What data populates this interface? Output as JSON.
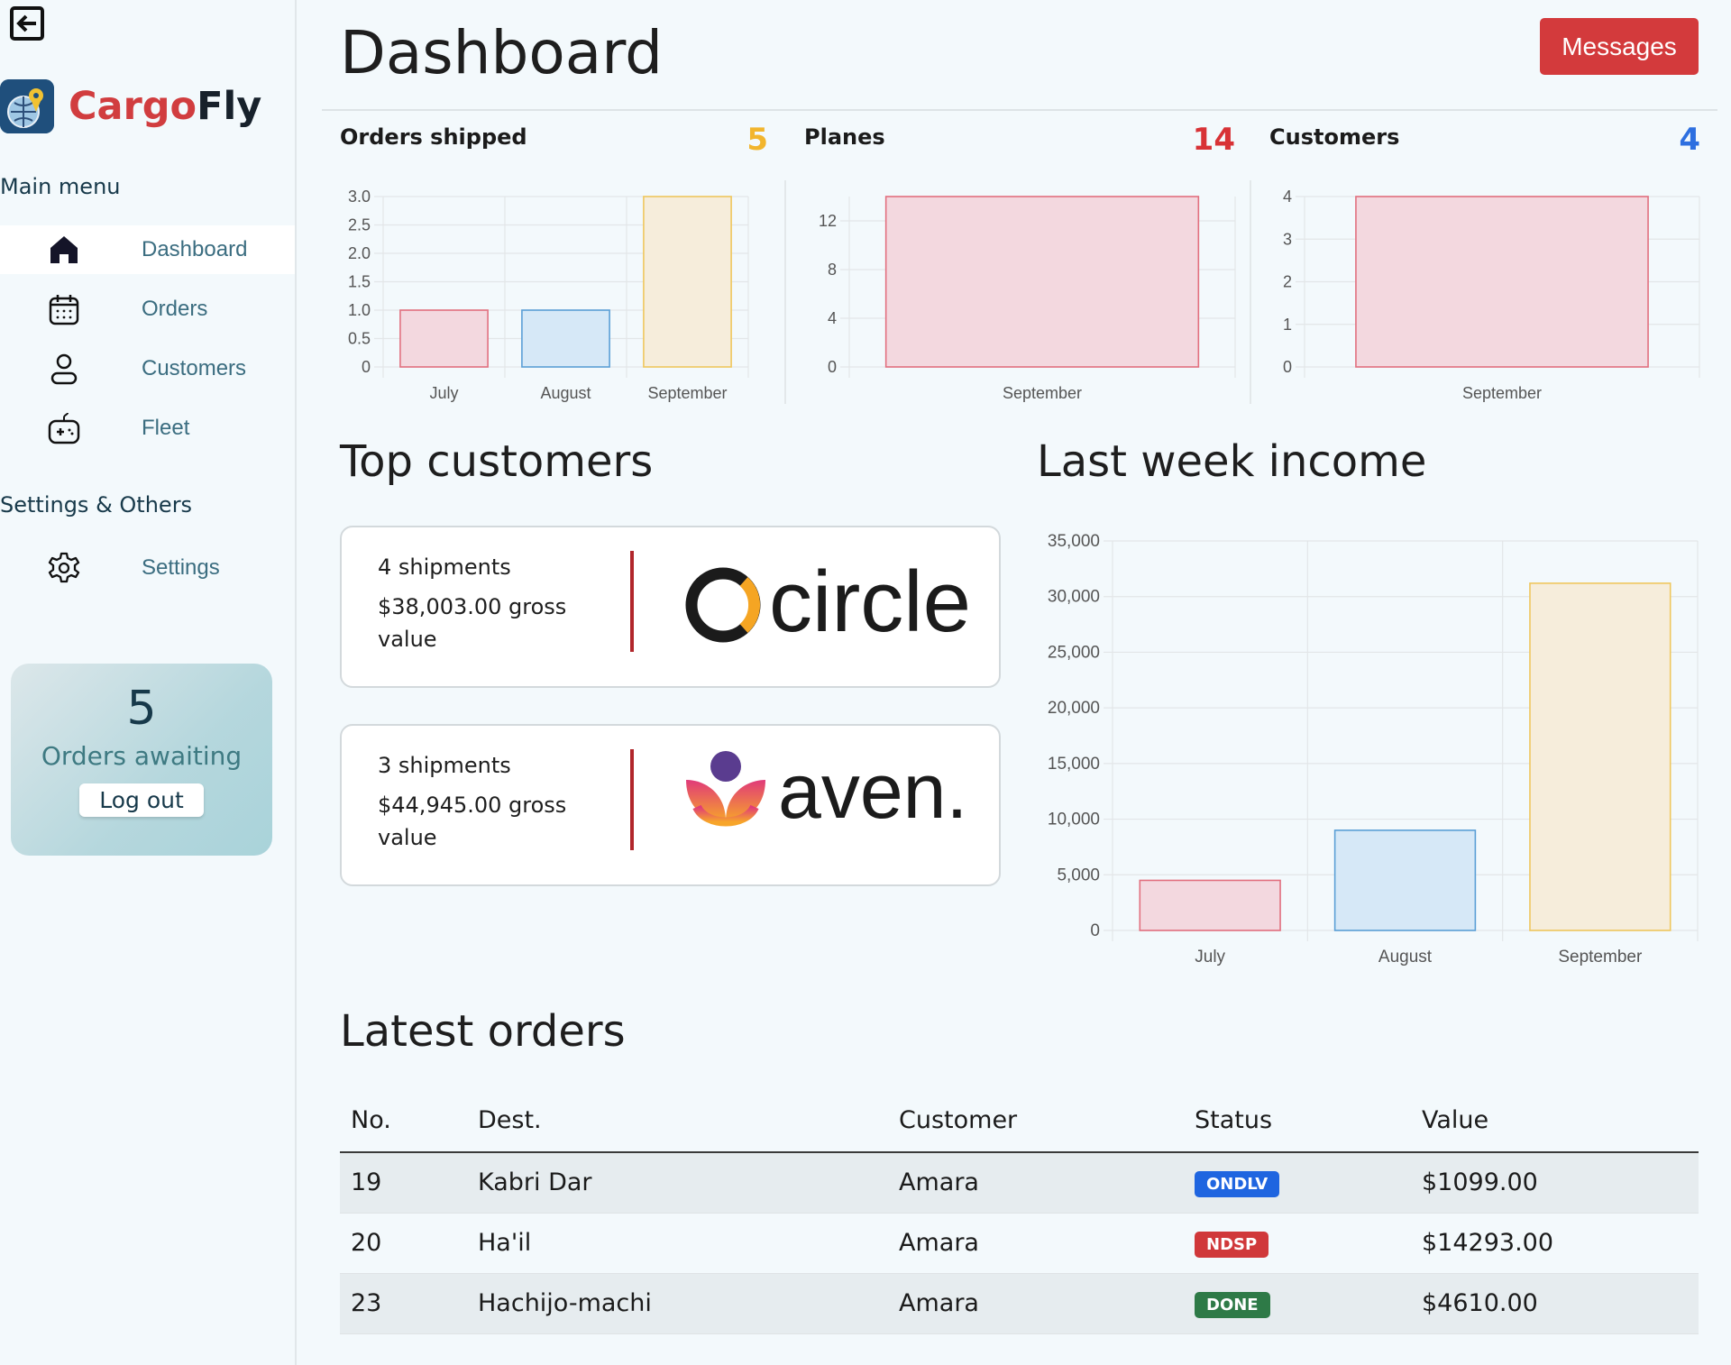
{
  "sidebar": {
    "brand": {
      "part1": "Cargo",
      "part2": "Fly"
    },
    "main_menu_title": "Main menu",
    "items": [
      {
        "label": "Dashboard",
        "icon": "home-icon",
        "active": true
      },
      {
        "label": "Orders",
        "icon": "calendar-icon"
      },
      {
        "label": "Customers",
        "icon": "user-icon"
      },
      {
        "label": "Fleet",
        "icon": "gamepad-icon"
      }
    ],
    "settings_title": "Settings & Others",
    "settings_items": [
      {
        "label": "Settings",
        "icon": "gear-icon"
      }
    ],
    "awaiting": {
      "count": "5",
      "label": "Orders awaiting",
      "logout": "Log out"
    }
  },
  "header": {
    "title": "Dashboard",
    "messages_button": "Messages"
  },
  "kpis": [
    {
      "label": "Orders shipped",
      "value": "5",
      "color": "#f2b52d"
    },
    {
      "label": "Planes",
      "value": "14",
      "color": "#d83236"
    },
    {
      "label": "Customers",
      "value": "4",
      "color": "#2d6fe0"
    }
  ],
  "sections": {
    "top_customers": "Top customers",
    "last_week_income": "Last week income",
    "latest_orders": "Latest orders"
  },
  "top_customers": [
    {
      "shipments": "4 shipments",
      "gross": "$38,003.00 gross value",
      "logo": "circle"
    },
    {
      "shipments": "3 shipments",
      "gross": "$44,945.00 gross value",
      "logo": "aven."
    }
  ],
  "orders_table": {
    "headers": [
      "No.",
      "Dest.",
      "Customer",
      "Status",
      "Value"
    ],
    "rows": [
      {
        "no": "19",
        "dest": "Kabri Dar",
        "customer": "Amara",
        "status": "ONDLV",
        "status_color": "#1f65e0",
        "value": "$1099.00"
      },
      {
        "no": "20",
        "dest": "Ha'il",
        "customer": "Amara",
        "status": "NDSP",
        "status_color": "#d0383a",
        "value": "$14293.00"
      },
      {
        "no": "23",
        "dest": "Hachijo-machi",
        "customer": "Amara",
        "status": "DONE",
        "status_color": "#2e7a47",
        "value": "$4610.00"
      }
    ]
  },
  "chart_data": [
    {
      "type": "bar",
      "categories": [
        "July",
        "August",
        "September"
      ],
      "values": [
        1,
        1,
        3
      ],
      "ylim": [
        0,
        3
      ],
      "yticks": [
        "0",
        "0.5",
        "1.0",
        "1.5",
        "2.0",
        "2.5",
        "3.0"
      ],
      "ytick_values": [
        0,
        0.5,
        1,
        1.5,
        2,
        2.5,
        3
      ]
    },
    {
      "type": "bar",
      "categories": [
        "September"
      ],
      "values": [
        14
      ],
      "ylim": [
        0,
        14
      ],
      "yticks": [
        "0",
        "4",
        "8",
        "12"
      ],
      "ytick_values": [
        0,
        4,
        8,
        12
      ]
    },
    {
      "type": "bar",
      "categories": [
        "September"
      ],
      "values": [
        4
      ],
      "ylim": [
        0,
        4
      ],
      "yticks": [
        "0",
        "1",
        "2",
        "3",
        "4"
      ],
      "ytick_values": [
        0,
        1,
        2,
        3,
        4
      ]
    },
    {
      "type": "bar",
      "categories": [
        "July",
        "August",
        "September"
      ],
      "values": [
        4500,
        9000,
        31200
      ],
      "ylim": [
        0,
        35000
      ],
      "yticks": [
        "0",
        "5,000",
        "10,000",
        "15,000",
        "20,000",
        "25,000",
        "30,000",
        "35,000"
      ],
      "ytick_values": [
        0,
        5000,
        10000,
        15000,
        20000,
        25000,
        30000,
        35000
      ]
    }
  ],
  "bar_colors": [
    {
      "fill": "#f3d8df",
      "stroke": "#e2707f"
    },
    {
      "fill": "#d6e8f7",
      "stroke": "#5b9fd6"
    },
    {
      "fill": "#f6eddb",
      "stroke": "#efc75e"
    }
  ]
}
